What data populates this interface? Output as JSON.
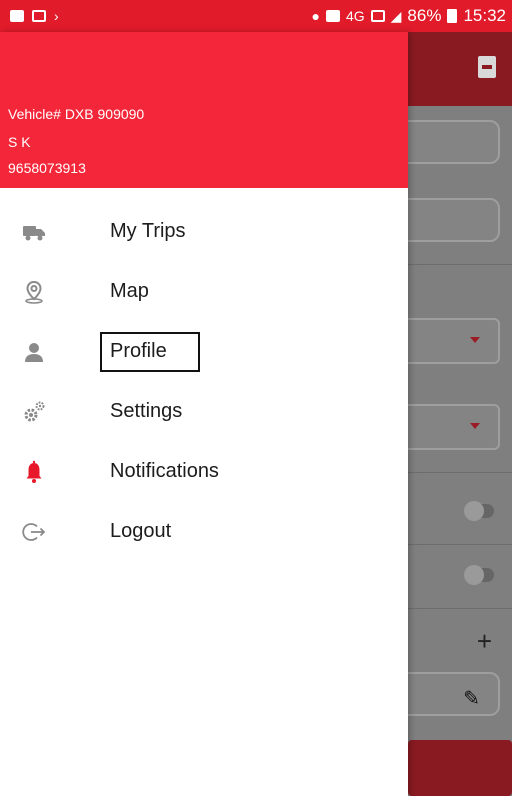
{
  "statusbar": {
    "battery": "86%",
    "time": "15:32",
    "network": "4G",
    "icons": [
      "photo-icon",
      "message-icon",
      "arrow-icon",
      "location-icon",
      "sim-icon",
      "wifi-icon",
      "signal-icon",
      "battery-icon"
    ]
  },
  "drawer": {
    "vehicle": "Vehicle# DXB 909090",
    "name": "S K",
    "phone": "9658073913",
    "items": [
      {
        "label": "My Trips",
        "icon": "truck-icon"
      },
      {
        "label": "Map",
        "icon": "map-pin-icon"
      },
      {
        "label": "Profile",
        "icon": "person-icon"
      },
      {
        "label": "Settings",
        "icon": "gears-icon"
      },
      {
        "label": "Notifications",
        "icon": "bell-icon"
      },
      {
        "label": "Logout",
        "icon": "logout-icon"
      }
    ]
  },
  "background": {
    "plus": "+"
  },
  "colors": {
    "brand": "#f4273a",
    "statusbar": "#e11b2a",
    "notification_icon": "#e8182b"
  }
}
